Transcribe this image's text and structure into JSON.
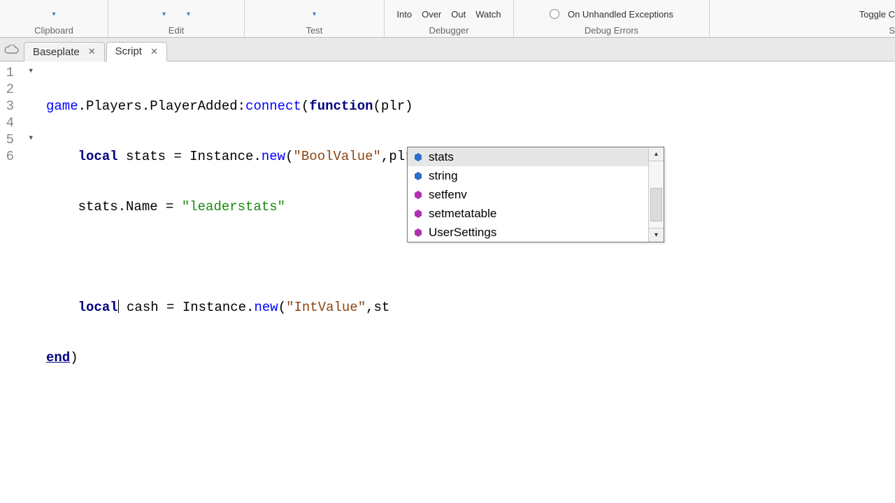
{
  "ribbon": {
    "clipboard": {
      "label": "Clipboard"
    },
    "edit": {
      "label": "Edit"
    },
    "test": {
      "label": "Test"
    },
    "debugger": {
      "label": "Debugger",
      "into": "Into",
      "over": "Over",
      "out": "Out",
      "watch": "Watch"
    },
    "errors": {
      "label": "Debug Errors",
      "on_unhandled": "On Unhandled Exceptions"
    },
    "last": {
      "toggle": "Toggle C",
      "s": "S"
    }
  },
  "tabs": [
    {
      "label": "Baseplate",
      "active": false
    },
    {
      "label": "Script",
      "active": true
    }
  ],
  "code": {
    "lines": [
      "1",
      "2",
      "3",
      "4",
      "5",
      "6"
    ],
    "l1_game": "game",
    "l1_players": ".Players.PlayerAdded:",
    "l1_connect": "connect",
    "l1_open": "(",
    "l1_function": "function",
    "l1_params": "(plr)",
    "l2_indent": "    ",
    "l2_local": "local",
    "l2_rest1": " stats = Instance.",
    "l2_new": "new",
    "l2_open": "(",
    "l2_str": "\"BoolValue\"",
    "l2_rest2": ",plr)",
    "l3_indent": "    ",
    "l3_rest": "stats.Name = ",
    "l3_str": "\"leaderstats\"",
    "l5_indent": "    ",
    "l5_local": "local",
    "l5_rest1": " cash = Instance.",
    "l5_new": "new",
    "l5_open": "(",
    "l5_str": "\"IntValue\"",
    "l5_rest2": ",st",
    "l6_end": "end",
    "l6_paren": ")"
  },
  "autocomplete": {
    "items": [
      {
        "label": "stats",
        "kind": "var",
        "selected": true
      },
      {
        "label": "string",
        "kind": "var",
        "selected": false
      },
      {
        "label": "setfenv",
        "kind": "fn",
        "selected": false
      },
      {
        "label": "setmetatable",
        "kind": "fn",
        "selected": false
      },
      {
        "label": "UserSettings",
        "kind": "fn",
        "selected": false
      }
    ]
  }
}
